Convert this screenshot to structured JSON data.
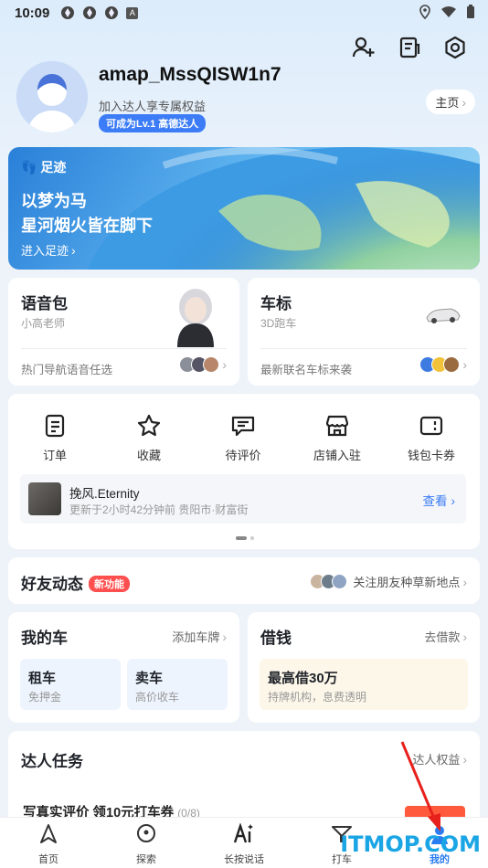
{
  "status_bar": {
    "time": "10:09",
    "signal_a": "A"
  },
  "profile": {
    "username": "amap_MssQISW1n7",
    "subtitle": "加入达人享专属权益",
    "level_badge": "可成为Lv.1 高德达人",
    "home_button": "主页"
  },
  "banner": {
    "tag": "足迹",
    "line1": "以梦为马",
    "line2": "星河烟火皆在脚下",
    "cta": "进入足迹"
  },
  "voice_card": {
    "title": "语音包",
    "subtitle": "小高老师",
    "footer": "热门导航语音任选"
  },
  "carlogo_card": {
    "title": "车标",
    "subtitle": "3D跑车",
    "footer": "最新联名车标来袭"
  },
  "shortcuts": [
    {
      "label": "订单",
      "icon": "order-icon"
    },
    {
      "label": "收藏",
      "icon": "star-icon"
    },
    {
      "label": "待评价",
      "icon": "comment-icon"
    },
    {
      "label": "店铺入驻",
      "icon": "store-icon"
    },
    {
      "label": "钱包卡券",
      "icon": "wallet-icon"
    }
  ],
  "recent": {
    "name": "挽风.Eternity",
    "detail": "更新于2小时42分钟前 贵阳市·财富街",
    "action": "查看"
  },
  "friends": {
    "title": "好友动态",
    "badge": "新功能",
    "right": "关注朋友种草新地点"
  },
  "mycar": {
    "title": "我的车",
    "right": "添加车牌",
    "tile1_title": "租车",
    "tile1_sub": "免押金",
    "tile2_title": "卖车",
    "tile2_sub": "高价收车"
  },
  "loan": {
    "title": "借钱",
    "right": "去借款",
    "tile_title": "最高借30万",
    "tile_sub": "持牌机构，息费透明"
  },
  "tasks": {
    "title": "达人任务",
    "right": "达人权益",
    "item": "写真实评价 领10元打车券",
    "progress": "(0/8)"
  },
  "tabbar": [
    {
      "label": "首页",
      "icon": "navigate-icon"
    },
    {
      "label": "探索",
      "icon": "location-icon"
    },
    {
      "label": "长按说话",
      "icon": "ai-icon"
    },
    {
      "label": "打车",
      "icon": "taxi-icon"
    },
    {
      "label": "我的",
      "icon": "me-icon"
    }
  ],
  "watermark": "ITMOP.COM",
  "colors": {
    "accent": "#3c7cf6",
    "badge_red": "#ff4f4f"
  }
}
